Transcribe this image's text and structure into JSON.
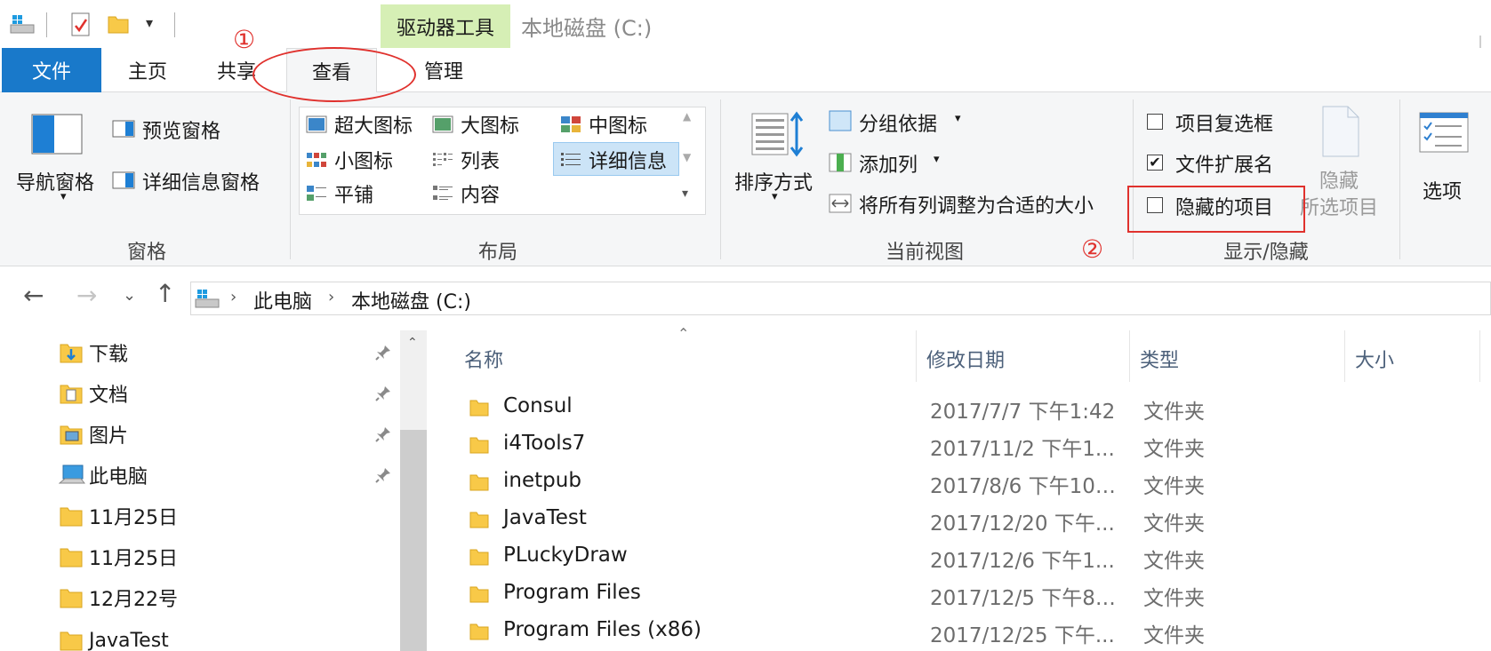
{
  "titlebar": {
    "contextual_tab": "驱动器工具",
    "window_title": "本地磁盘 (C:)"
  },
  "ribbon_tabs": [
    "文件",
    "主页",
    "共享",
    "查看",
    "管理"
  ],
  "ribbon": {
    "panes_group": {
      "label": "窗格",
      "nav_pane": "导航窗格",
      "preview_pane": "预览窗格",
      "details_pane": "详细信息窗格"
    },
    "layout_group": {
      "label": "布局",
      "items": [
        "超大图标",
        "大图标",
        "中图标",
        "小图标",
        "列表",
        "详细信息",
        "平铺",
        "内容"
      ],
      "selected": "详细信息"
    },
    "current_view_group": {
      "label": "当前视图",
      "sort_by": "排序方式",
      "group_by": "分组依据",
      "add_columns": "添加列",
      "size_all_columns": "将所有列调整为合适的大小"
    },
    "show_hide_group": {
      "label": "显示/隐藏",
      "item_checkboxes": {
        "label": "项目复选框",
        "checked": false
      },
      "file_extensions": {
        "label": "文件扩展名",
        "checked": true
      },
      "hidden_items": {
        "label": "隐藏的项目",
        "checked": false
      },
      "hide_selected_line1": "隐藏",
      "hide_selected_line2": "所选项目"
    },
    "options_label": "选项"
  },
  "annotations": {
    "marker1": "①",
    "marker2": "②",
    "color": "#e0312d"
  },
  "address_bar": {
    "crumbs": [
      "此电脑",
      "本地磁盘 (C:)"
    ]
  },
  "nav_pane": {
    "items": [
      {
        "label": "下载",
        "pinned": true
      },
      {
        "label": "文档",
        "pinned": true
      },
      {
        "label": "图片",
        "pinned": true
      },
      {
        "label": "此电脑",
        "pinned": true
      },
      {
        "label": "11月25日",
        "pinned": false
      },
      {
        "label": "11月25日",
        "pinned": false
      },
      {
        "label": "12月22号",
        "pinned": false
      },
      {
        "label": "JavaTest",
        "pinned": false
      }
    ]
  },
  "file_list": {
    "columns": [
      "名称",
      "修改日期",
      "类型",
      "大小"
    ],
    "rows": [
      {
        "name": "Consul",
        "date": "2017/7/7 下午1:42",
        "type": "文件夹"
      },
      {
        "name": "i4Tools7",
        "date": "2017/11/2 下午1...",
        "type": "文件夹"
      },
      {
        "name": "inetpub",
        "date": "2017/8/6 下午10:...",
        "type": "文件夹"
      },
      {
        "name": "JavaTest",
        "date": "2017/12/20 下午...",
        "type": "文件夹"
      },
      {
        "name": "PLuckyDraw",
        "date": "2017/12/6 下午1...",
        "type": "文件夹"
      },
      {
        "name": "Program Files",
        "date": "2017/12/5 下午8:...",
        "type": "文件夹"
      },
      {
        "name": "Program Files (x86)",
        "date": "2017/12/25 下午...",
        "type": "文件夹"
      }
    ]
  },
  "colors": {
    "file_tab": "#1979ca",
    "drive_tools_tab": "#d6efb5",
    "selection": "#cce4f7",
    "folder": "#f8c948"
  }
}
